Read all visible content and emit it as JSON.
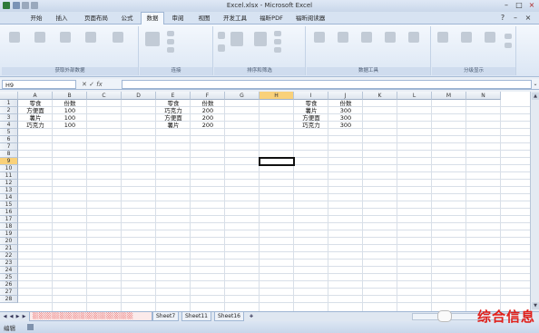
{
  "window": {
    "title": "Excel.xlsx - Microsoft Excel"
  },
  "ribbon_tabs": [
    "开始",
    "插入",
    "页面布局",
    "公式",
    "数据",
    "审阅",
    "视图",
    "开发工具",
    "福昕PDF",
    "福昕阅读器"
  ],
  "active_tab": "数据",
  "ribbon_groups": [
    "获取外部数据",
    "连接",
    "排序和筛选",
    "数据工具",
    "分级显示"
  ],
  "formula_bar": {
    "name_box": "H9",
    "fx_label": "fx",
    "formula": ""
  },
  "columns": [
    "A",
    "B",
    "C",
    "D",
    "E",
    "F",
    "G",
    "H",
    "I",
    "J",
    "K",
    "L",
    "M",
    "N"
  ],
  "selected_column": "H",
  "rows": [
    "1",
    "2",
    "3",
    "4",
    "5",
    "6",
    "7",
    "8",
    "9",
    "10",
    "11",
    "12",
    "13",
    "14",
    "15",
    "16",
    "17",
    "18",
    "19",
    "20",
    "21",
    "22",
    "23",
    "24",
    "25",
    "26",
    "27",
    "28"
  ],
  "selected_row": "9",
  "cells": {
    "A1": "零食",
    "B1": "份数",
    "A2": "方便面",
    "B2": "100",
    "A3": "薯片",
    "B3": "100",
    "A4": "巧克力",
    "B4": "100",
    "E1": "零食",
    "F1": "份数",
    "E2": "巧克力",
    "F2": "200",
    "E3": "方便面",
    "F3": "200",
    "E4": "薯片",
    "F4": "200",
    "I1": "零食",
    "J1": "份数",
    "I2": "薯片",
    "J2": "300",
    "I3": "方便面",
    "J3": "300",
    "I4": "巧克力",
    "J4": "300"
  },
  "sheet_tabs": [
    "Sheet7",
    "Sheet11",
    "Sheet16"
  ],
  "status": {
    "mode": "编辑"
  },
  "watermark": "综合信息",
  "colors": {
    "selection": "#f9d17a",
    "watermark": "#e0201b",
    "active_tab_bg": "#f4f8fd"
  }
}
